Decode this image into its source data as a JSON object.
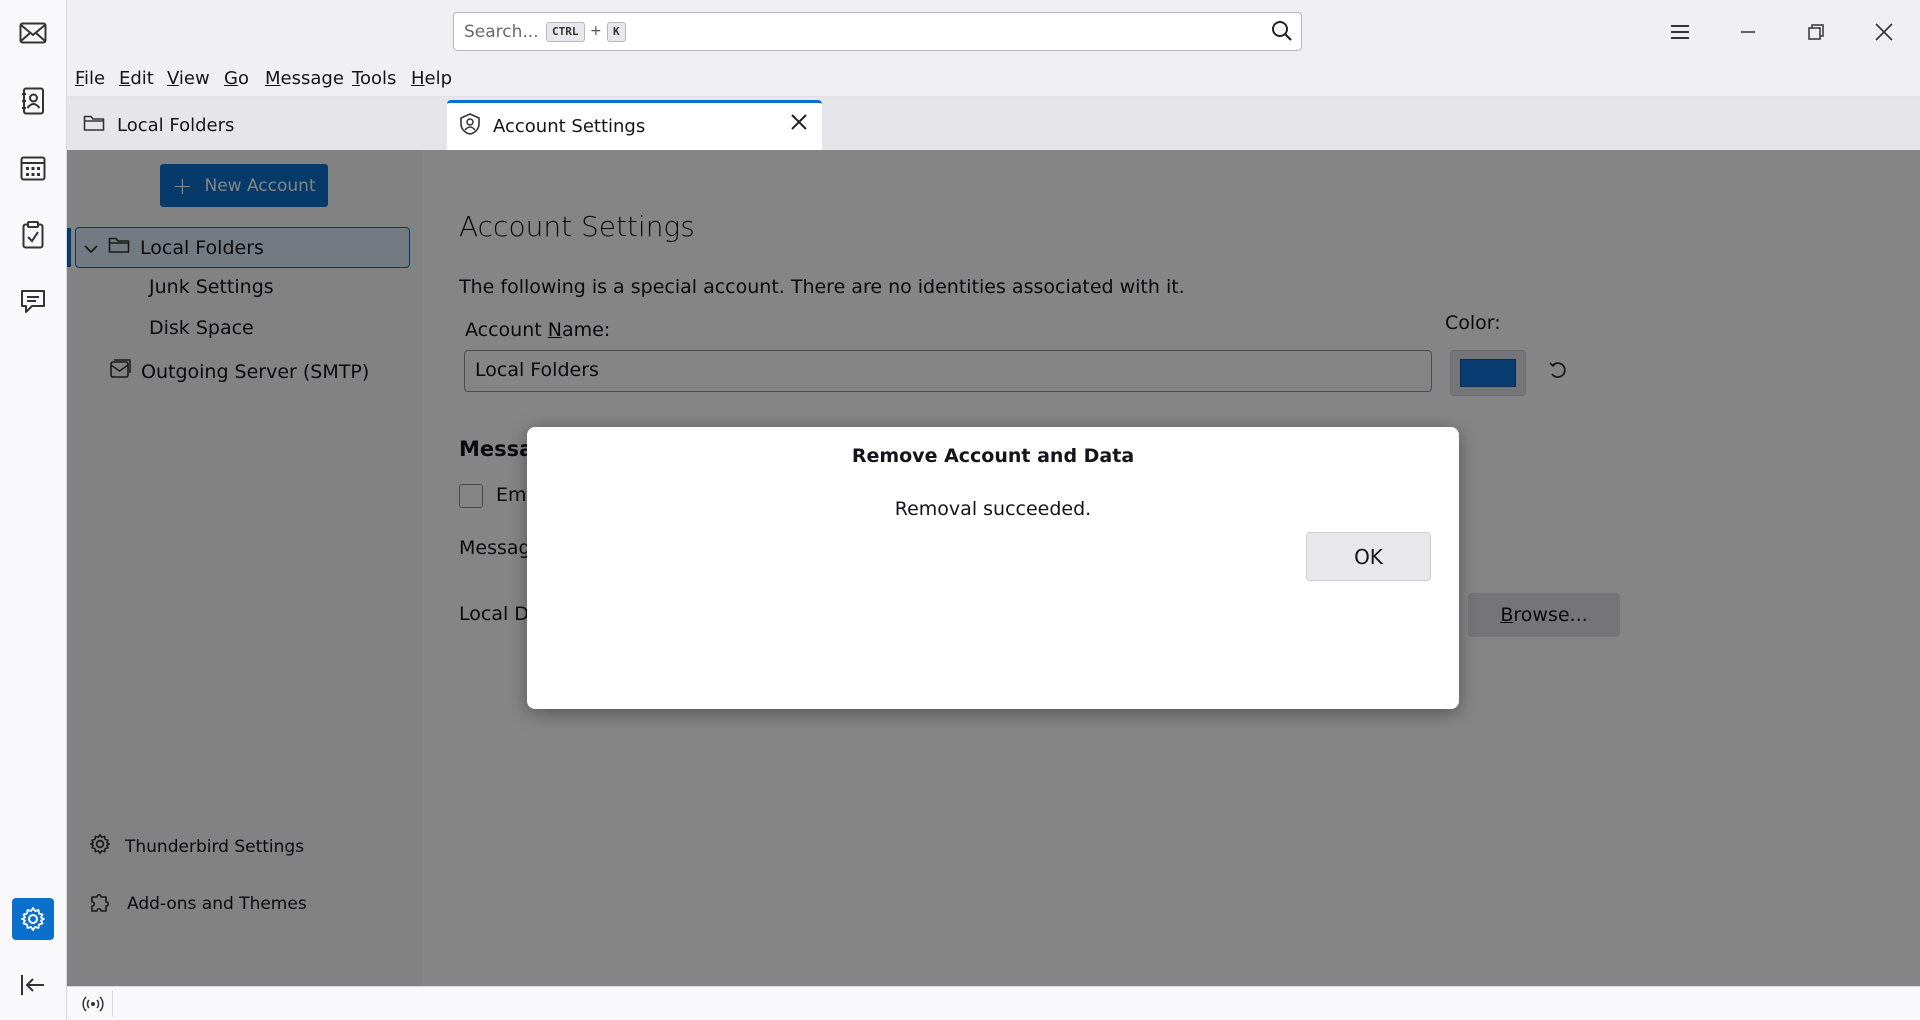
{
  "search": {
    "placeholder": "Search...",
    "shortcut_mod": "CTRL",
    "shortcut_plus": "+",
    "shortcut_key": "K"
  },
  "menubar": {
    "items": [
      {
        "first": "F",
        "rest": "ile"
      },
      {
        "first": "E",
        "rest": "dit"
      },
      {
        "first": "V",
        "rest": "iew"
      },
      {
        "first": "G",
        "rest": "o"
      },
      {
        "first": "M",
        "rest": "essage"
      },
      {
        "first": "T",
        "rest": "ools"
      },
      {
        "first": "H",
        "rest": "elp"
      }
    ]
  },
  "tabs": {
    "local_folders": "Local Folders",
    "account_settings": "Account Settings"
  },
  "sidebar": {
    "new_account": "New Account",
    "tree": {
      "local_folders": "Local Folders",
      "junk_settings": "Junk Settings",
      "disk_space": "Disk Space",
      "outgoing_server": "Outgoing Server (SMTP)"
    },
    "footer": {
      "settings": "Thunderbird Settings",
      "addons": "Add-ons and Themes"
    }
  },
  "main": {
    "title": "Account Settings",
    "intro": "The following is a special account. There are no identities associated with it.",
    "name_label_pre": "Account ",
    "name_label_ul": "N",
    "name_label_post": "ame:",
    "name_value": "Local Folders",
    "color_label": "Color:",
    "color_value": "#1373d9",
    "section_heading": "Messag",
    "empty_label": "Emp",
    "message_storage": "Messag",
    "local_directory": "Local Di",
    "browse_ul": "B",
    "browse_rest": "rowse..."
  },
  "dialog": {
    "title": "Remove Account and Data",
    "message": "Removal succeeded.",
    "ok": "OK"
  },
  "colors": {
    "accent": "#0a70cc"
  }
}
